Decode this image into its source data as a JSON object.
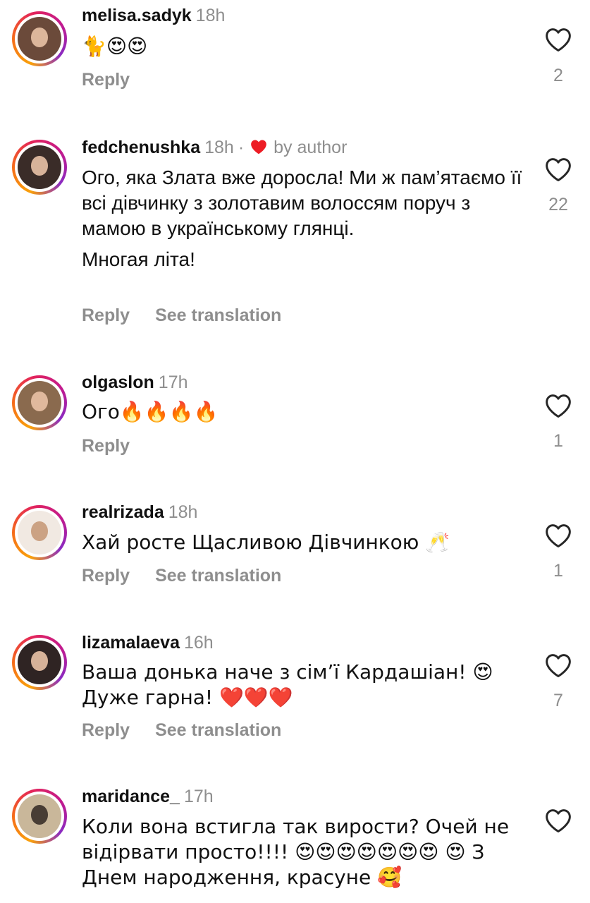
{
  "comments": [
    {
      "username": "melisa.sadyk",
      "time": "18h",
      "text": [
        "🐈😍😍"
      ],
      "actions": {
        "reply": "Reply",
        "translate": ""
      },
      "likes": "2",
      "avatar_color": "#6b4a3a"
    },
    {
      "username": "fedchenushka",
      "time": "18h",
      "separator": "·",
      "liked_by_author": "by author",
      "text": [
        "Ого, яка Злата вже доросла! Ми ж пам’ятаємо її всі дівчинку з золотавим волоссям поруч з мамою в українському глянці.",
        "Многая літа!"
      ],
      "actions": {
        "reply": "Reply",
        "translate": "See translation"
      },
      "likes": "22",
      "avatar_color": "#3a2c28"
    },
    {
      "username": "olgaslon",
      "time": "17h",
      "text": [
        "Ого🔥🔥🔥🔥"
      ],
      "actions": {
        "reply": "Reply",
        "translate": ""
      },
      "likes": "1",
      "avatar_color": "#8a6a4e"
    },
    {
      "username": "realrizada",
      "time": "18h",
      "text": [
        "Хай росте Щасливою Дівчинкою 🥂"
      ],
      "actions": {
        "reply": "Reply",
        "translate": "See translation"
      },
      "likes": "1",
      "avatar_color": "#f1e9e2"
    },
    {
      "username": "lizamalaeva",
      "time": "16h",
      "text": [
        "Ваша донька наче з сім’ї Кардашіан! 😍 Дуже гарна! ❤️❤️❤️"
      ],
      "actions": {
        "reply": "Reply",
        "translate": "See translation"
      },
      "likes": "7",
      "avatar_color": "#2f2423"
    },
    {
      "username": "maridance_",
      "time": "17h",
      "text": [
        "Коли вона встигла так вирости? Очей не відірвати просто!!!! 😍😍😍😍😍😍😍 😍 З Днем народження, красуне 🥰"
      ],
      "actions": {
        "reply": "",
        "translate": ""
      },
      "likes": "",
      "avatar_color": "#c9b79a"
    }
  ],
  "colors": {
    "primary_text": "#111111",
    "secondary_text": "#8e8e8e",
    "author_heart": "#ed1c24",
    "story_ring": [
      "#f9a10b",
      "#e3245a",
      "#8a2bc2"
    ]
  },
  "icons": {
    "like": "heart-outline-icon",
    "author_like": "heart-filled-icon"
  }
}
